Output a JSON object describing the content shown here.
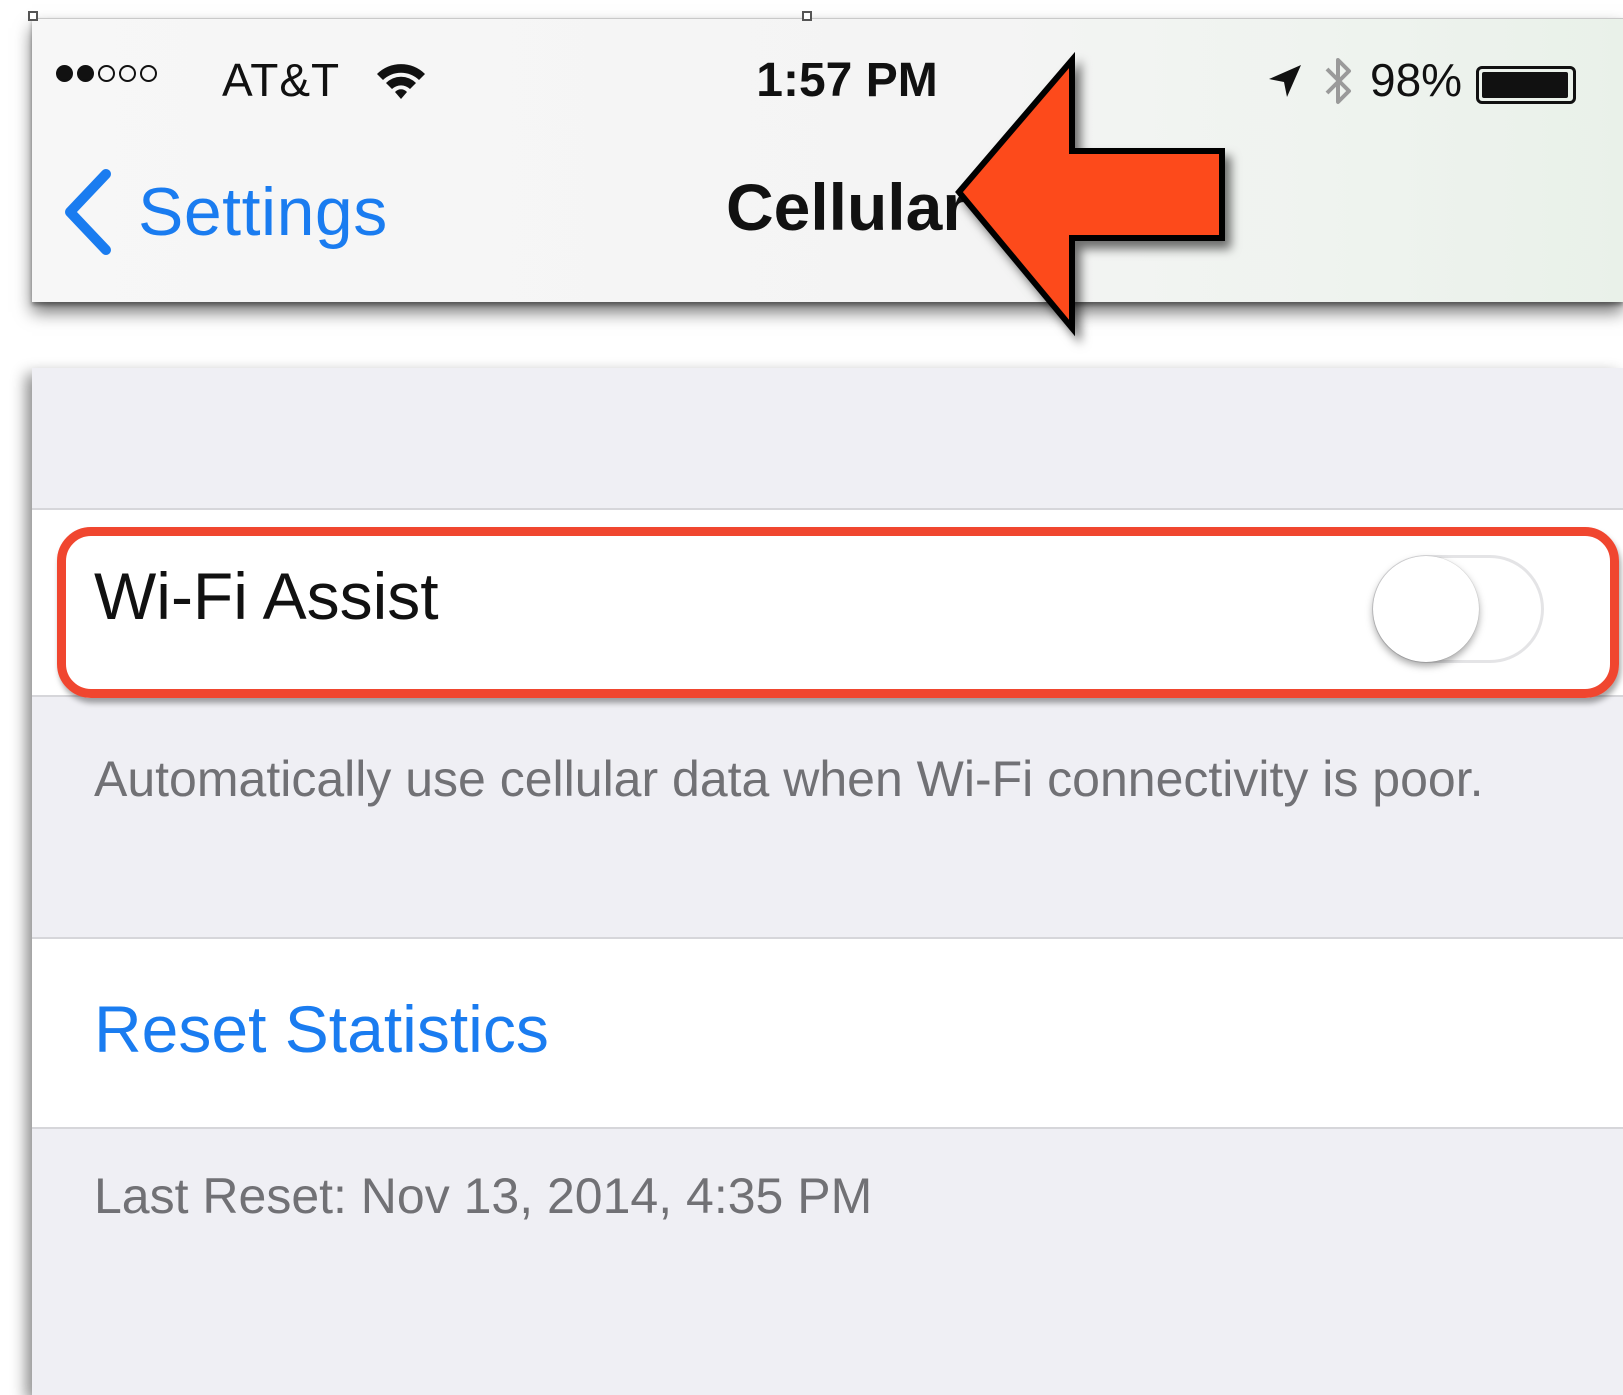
{
  "status_bar": {
    "signal_strength": 2,
    "signal_max": 5,
    "carrier": "AT&T",
    "wifi_icon": "wifi-icon",
    "time": "1:57 PM",
    "location_icon": "location-arrow-icon",
    "bluetooth_icon": "bluetooth-icon",
    "battery_percent": "98%",
    "battery_level": 0.98
  },
  "nav": {
    "back_label": "Settings",
    "title": "Cellular"
  },
  "wifi_assist": {
    "label": "Wi-Fi Assist",
    "enabled": false,
    "description": "Automatically use cellular data when Wi-Fi connectivity is poor."
  },
  "reset": {
    "label": "Reset Statistics",
    "last_reset": "Last Reset: Nov 13, 2014, 4:35 PM"
  },
  "annotations": {
    "arrow_color": "#fd4a1b",
    "highlight_color": "#f0462f"
  },
  "colors": {
    "ios_blue": "#1a7cf0",
    "grouped_background": "#efeff4",
    "secondary_text": "#717175"
  }
}
